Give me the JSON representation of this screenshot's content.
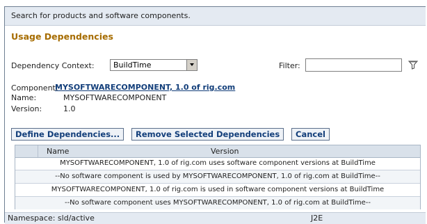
{
  "header": {
    "hint": "Search for products and software components."
  },
  "section": {
    "title": "Usage Dependencies"
  },
  "context": {
    "label": "Dependency Context:",
    "selected": "BuildTime"
  },
  "filter": {
    "label": "Filter:",
    "value": "",
    "icon": "filter-funnel-icon"
  },
  "component": {
    "label": "Component:",
    "link_text": "MYSOFTWARECOMPONENT, 1.0 of rig.com",
    "name_label": "Name:",
    "name_value": "MYSOFTWARECOMPONENT",
    "version_label": "Version:",
    "version_value": "1.0"
  },
  "buttons": {
    "define": "Define Dependencies...",
    "remove": "Remove Selected Dependencies",
    "cancel": "Cancel"
  },
  "table": {
    "columns": [
      "Name",
      "Version"
    ],
    "rows": [
      "MYSOFTWARECOMPONENT, 1.0 of rig.com uses software component versions at BuildTime",
      "--No software component is used by MYSOFTWARECOMPONENT, 1.0 of rig.com at BuildTime--",
      "MYSOFTWARECOMPONENT, 1.0 of rig.com is used in software component versions at BuildTime",
      "--No software component uses MYSOFTWARECOMPONENT, 1.0 of rig.com at BuildTime--"
    ]
  },
  "status": {
    "namespace": "Namespace: sld/active",
    "right": "J2E"
  }
}
